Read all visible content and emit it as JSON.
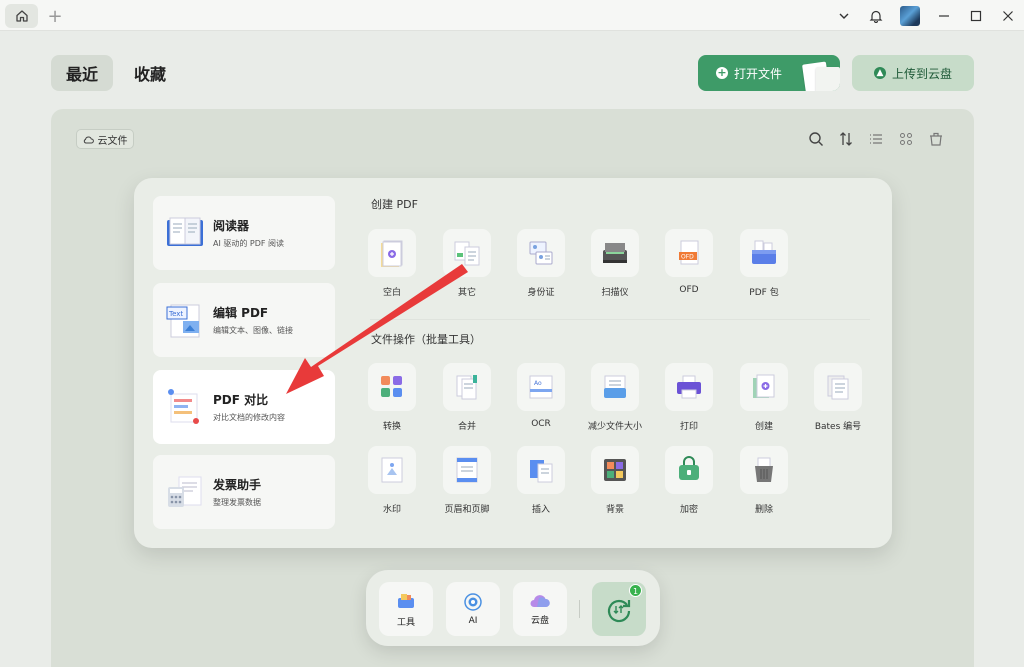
{
  "titlebar": {
    "icons": [
      "home-icon",
      "plus-icon",
      "chevron-down-icon",
      "bell-icon",
      "avatar",
      "minimize-icon",
      "maximize-icon",
      "close-icon"
    ]
  },
  "header": {
    "tabs": [
      {
        "label": "最近",
        "active": true
      },
      {
        "label": "收藏",
        "active": false
      }
    ],
    "open_file_label": "打开文件",
    "upload_label": "上传到云盘"
  },
  "content": {
    "cloud_chip_label": "云文件",
    "toolbar_icons": [
      "search-icon",
      "sort-icon",
      "list-view-icon",
      "grid-view-icon",
      "recycle-icon"
    ]
  },
  "features": [
    {
      "title": "阅读器",
      "subtitle": "AI 驱动的 PDF 阅读"
    },
    {
      "title": "编辑 PDF",
      "subtitle": "编辑文本、图像、链接"
    },
    {
      "title": "PDF 对比",
      "subtitle": "对比文档的修改内容"
    },
    {
      "title": "发票助手",
      "subtitle": "整理发票数据"
    }
  ],
  "create_section": {
    "title": "创建 PDF",
    "items": [
      "空白",
      "其它",
      "身份证",
      "扫描仪",
      "OFD",
      "PDF 包"
    ]
  },
  "ops_section": {
    "title": "文件操作（批量工具）",
    "items": [
      "转换",
      "合并",
      "OCR",
      "减少文件大小",
      "打印",
      "创建",
      "Bates 编号",
      "水印",
      "页眉和页脚",
      "插入",
      "背景",
      "加密",
      "删除"
    ]
  },
  "dock": {
    "items": [
      "工具",
      "AI",
      "云盘"
    ],
    "sync_badge": "1"
  },
  "colors": {
    "accent": "#3e9b68",
    "panel": "#d9dfd6",
    "arrow": "#e83a3a"
  }
}
